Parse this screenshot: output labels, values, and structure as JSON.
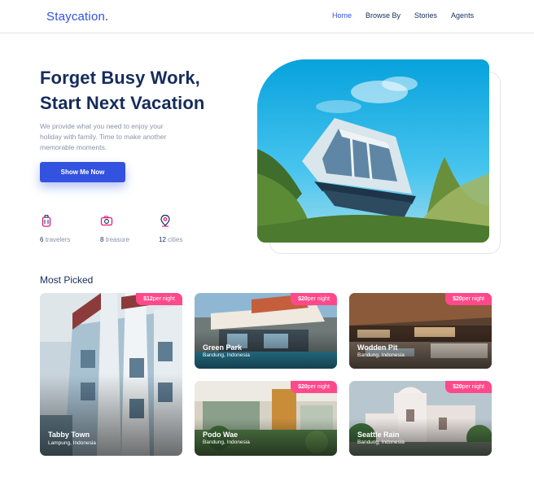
{
  "nav": {
    "brand_main": "Staycation",
    "brand_dot": ".",
    "links": [
      "Home",
      "Browse By",
      "Stories",
      "Agents"
    ]
  },
  "hero": {
    "title_line1": "Forget Busy Work,",
    "title_line2": "Start Next Vacation",
    "description": "We provide what you need to enjoy your holiday with family. Time to make another memorable moments.",
    "cta_label": "Show Me Now"
  },
  "stats": [
    {
      "value": "6",
      "label": "travelers",
      "icon": "suitcase-icon"
    },
    {
      "value": "8",
      "label": "treasure",
      "icon": "camera-icon"
    },
    {
      "value": "12",
      "label": "cities",
      "icon": "map-pin-icon"
    }
  ],
  "most_picked": {
    "title": "Most Picked",
    "items": [
      {
        "name": "Tabby Town",
        "location": "Lampung, Indonesia",
        "price": "$12",
        "unit": "per night"
      },
      {
        "name": "Green Park",
        "location": "Bandung, Indonesia",
        "price": "$20",
        "unit": "per night"
      },
      {
        "name": "Wodden Pit",
        "location": "Bandung, Indonesia",
        "price": "$20",
        "unit": "per night"
      },
      {
        "name": "Podo Wae",
        "location": "Bandung, Indonesia",
        "price": "$20",
        "unit": "per night"
      },
      {
        "name": "Seattle Rain",
        "location": "Bandung, Indonesia",
        "price": "$20",
        "unit": "per night"
      }
    ]
  },
  "colors": {
    "primary": "#3252df",
    "navy": "#152c5b",
    "muted": "#8a93a6",
    "badge": "#ff498b",
    "icon_accent": "#e3187d"
  }
}
